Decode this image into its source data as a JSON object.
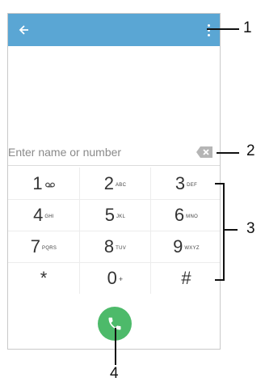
{
  "header": {
    "back_icon": "back-arrow-icon",
    "menu_icon": "more-vert-icon"
  },
  "input": {
    "placeholder": "Enter name or number",
    "value": ""
  },
  "backspace_icon": "backspace-icon",
  "keys": [
    {
      "digit": "1",
      "letters": ""
    },
    {
      "digit": "2",
      "letters": "ABC"
    },
    {
      "digit": "3",
      "letters": "DEF"
    },
    {
      "digit": "4",
      "letters": "GHI"
    },
    {
      "digit": "5",
      "letters": "JKL"
    },
    {
      "digit": "6",
      "letters": "MNO"
    },
    {
      "digit": "7",
      "letters": "PQRS"
    },
    {
      "digit": "8",
      "letters": "TUV"
    },
    {
      "digit": "9",
      "letters": "WXYZ"
    },
    {
      "digit": "*",
      "letters": ""
    },
    {
      "digit": "0",
      "letters": "+"
    },
    {
      "digit": "#",
      "letters": ""
    }
  ],
  "call_icon": "phone-handset-icon",
  "callouts": [
    "1",
    "2",
    "3",
    "4"
  ],
  "colors": {
    "appbar": "#5aa6d4",
    "call": "#4dba6a"
  }
}
